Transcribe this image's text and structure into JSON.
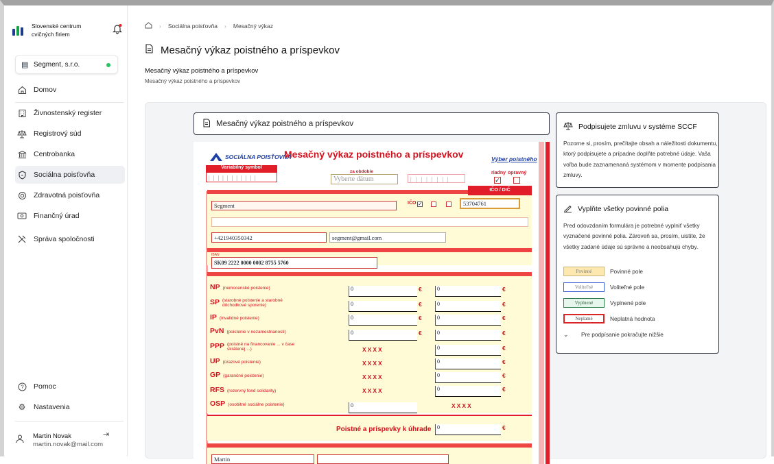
{
  "sidebar": {
    "org_name_line1": "Slovenské centrum",
    "org_name_line2": "cvičných firiem",
    "company": "Segment, s.r.o.",
    "nav": [
      {
        "label": "Domov",
        "icon": "home-icon"
      },
      {
        "label": "Živnostenský register",
        "icon": "building-icon"
      },
      {
        "label": "Registrový súd",
        "icon": "scales-icon"
      },
      {
        "label": "Centrobanka",
        "icon": "bank-icon"
      },
      {
        "label": "Sociálna poisťovňa",
        "icon": "shield-icon"
      },
      {
        "label": "Zdravotná poisťovňa",
        "icon": "health-icon"
      },
      {
        "label": "Finančný úrad",
        "icon": "money-icon"
      },
      {
        "label": "Správa spoločnosti",
        "icon": "tools-icon"
      }
    ],
    "help": "Pomoc",
    "settings": "Nastavenia",
    "user_name": "Martin Novak",
    "user_email": "martin.novak@mail.com"
  },
  "breadcrumb": {
    "item1": "Sociálna poisťovňa",
    "item2": "Mesačný výkaz"
  },
  "page_title": "Mesačný výkaz poistného a príspevkov",
  "section_title": "Mesačný výkaz poistného a príspevkov",
  "section_subtitle": "Mesačný výkaz poistného a príspevkov",
  "form_card_title": "Mesačný výkaz poistného a príspevkov",
  "form": {
    "brand": "SOCIÁLNA POISŤOVŇA",
    "title": "Mesačný výkaz poistného a príspevkov",
    "select_link": "Výber poistného",
    "variable_symbol_label": "Variabilný symbol",
    "period_label": "za obdobie",
    "date_placeholder": "Vyberte dátum",
    "regular_label": "riadny",
    "correction_label": "opravný",
    "ico_header": "IČO / DIČ",
    "ico_label": "IČO",
    "name_value": "Segment",
    "ico_value": "53704761",
    "phone_value": "+421940350342",
    "email_value": "segment@gmail.com",
    "iban_label": "IBAN",
    "iban_value": "SK09 2222 0000 0002 8755 5760",
    "rows": [
      {
        "code": "NP",
        "desc": "(nemocenské poistenie)"
      },
      {
        "code": "SP",
        "desc": "(starobné poistenie a starobné dôchodkové sporenie)"
      },
      {
        "code": "IP",
        "desc": "(invalidné poistenie)"
      },
      {
        "code": "PvN",
        "desc": "(poistenie v nezamestnanosti)"
      },
      {
        "code": "PPP",
        "desc": "(poistné na financovanie ... v čase skrátenej ...)"
      },
      {
        "code": "UP",
        "desc": "(úrazové poistenie)"
      },
      {
        "code": "GP",
        "desc": "(garančné poistenie)"
      },
      {
        "code": "RFS",
        "desc": "(rezervný fond solidarity)"
      },
      {
        "code": "OSP",
        "desc": "(osobitné sociálne poistenie)"
      }
    ],
    "zero": "0",
    "xxxx": "XXXX",
    "euro": "€",
    "total_label": "Poistné a príspevky k úhrade",
    "bottom_value": "Martin"
  },
  "sign_card": {
    "title": "Podpisujete zmluvu v systéme SCCF",
    "text": "Pozorne si, prosím, prečítajte obsah a náležitosti dokumentu, ktorý podpisujete a prípadne doplňte potrebné údaje. Vaša voľba bude zaznamenaná systémom v momente podpísania zmluvy."
  },
  "fill_card": {
    "title": "Vyplňte všetky povinné polia",
    "text": "Pred odovzdaním formulára je potrebné vyplniť všetky vyznačené povinné polia. Zároveň sa, prosím, uistite, že všetky zadané údaje sú správne a neobsahujú chyby.",
    "legend": [
      {
        "swatch": "Povinné",
        "label": "Povinné pole"
      },
      {
        "swatch": "Voliteľné",
        "label": "Voliteľné pole"
      },
      {
        "swatch": "Vyplnené",
        "label": "Vyplnené pole"
      },
      {
        "swatch": "Neplatné",
        "label": "Neplatná hodnota"
      }
    ],
    "continue": "Pre podpísanie pokračujte nižšie"
  }
}
